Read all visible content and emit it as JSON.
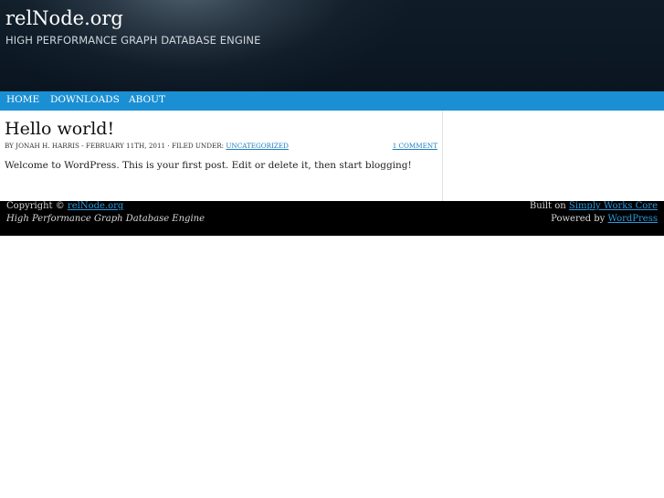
{
  "header": {
    "site_title": "relNode.org",
    "tagline": "HIGH PERFORMANCE GRAPH DATABASE ENGINE"
  },
  "nav": {
    "items": [
      "HOME",
      "DOWNLOADS",
      "ABOUT"
    ]
  },
  "post": {
    "title": "Hello world!",
    "meta_prefix": "BY JONAH H. HARRIS - FEBRUARY 11TH, 2011 · FILED UNDER: ",
    "category": "UNCATEGORIZED",
    "comments": "1 COMMENT",
    "body": "Welcome to WordPress. This is your first post. Edit or delete it, then start blogging!"
  },
  "footer": {
    "copyright_prefix": "Copyright © ",
    "copyright_link": "relNode.org",
    "tagline": "High Performance Graph Database Engine",
    "built_prefix": "Built on ",
    "built_link": "Simply Works Core",
    "powered_prefix": "Powered by ",
    "powered_link": "WordPress"
  },
  "colors": {
    "header_bg": "#0b1722",
    "nav_bg": "#1a8fd4",
    "link": "#1a7cc0",
    "footer_bg": "#000000"
  }
}
